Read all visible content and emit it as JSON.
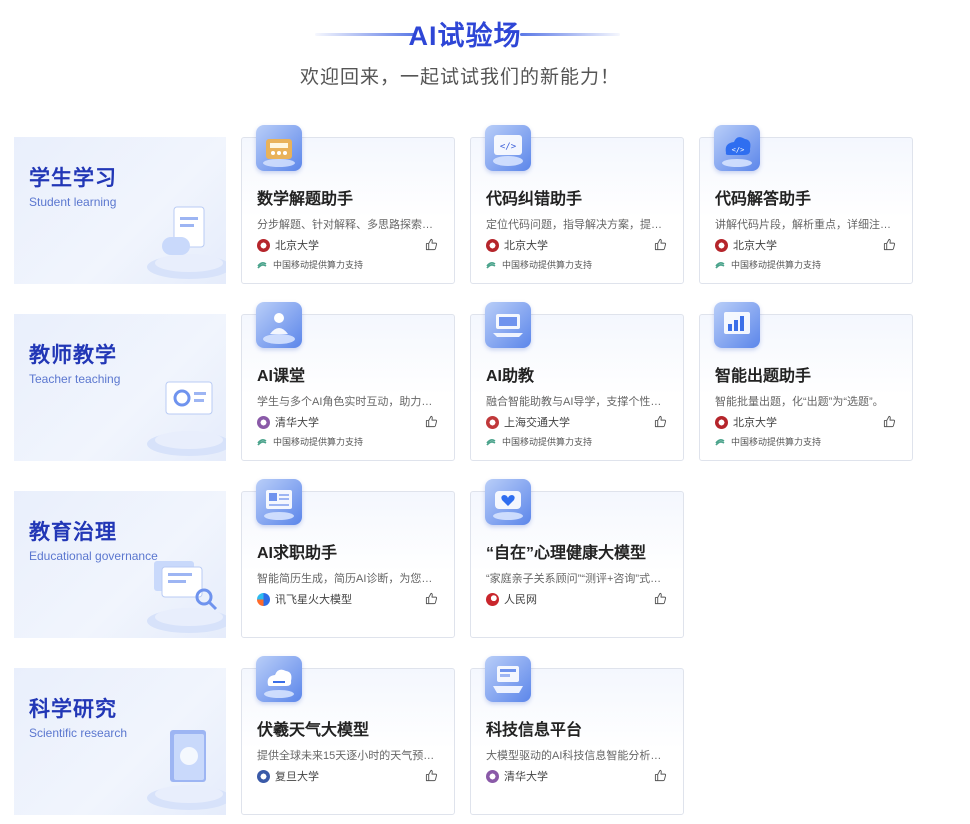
{
  "header": {
    "title": "AI试验场",
    "subtitle": "欢迎回来，一起试试我们的新能力！"
  },
  "power_text": "中国移动提供算力支持",
  "colors": {
    "accent": "#2e46d6",
    "category_bg": "#e9effc",
    "pku_red": "#b5252b",
    "tsinghua_purple": "#8a5aa8",
    "sjtu_red": "#c0383a",
    "cmcc_green": "#4aa38b"
  },
  "categories": [
    {
      "title": "学生学习",
      "subtitle": "Student learning",
      "illustration": "books-stack-icon",
      "cards": [
        {
          "title": "数学解题助手",
          "desc": "分步解题、针对解释、多思路探索…",
          "org": "北京大学",
          "icon": "math-calculator-icon",
          "power": true
        },
        {
          "title": "代码纠错助手",
          "desc": "定位代码问题，指导解决方案，提…",
          "org": "北京大学",
          "icon": "code-window-icon",
          "power": true
        },
        {
          "title": "代码解答助手",
          "desc": "讲解代码片段，解析重点，详细注…",
          "org": "北京大学",
          "icon": "cloud-code-icon",
          "power": true
        }
      ]
    },
    {
      "title": "教师教学",
      "subtitle": "Teacher teaching",
      "illustration": "teaching-screen-icon",
      "cards": [
        {
          "title": "AI课堂",
          "desc": "学生与多个AI角色实时互动，助力…",
          "org": "清华大学",
          "icon": "classroom-person-icon",
          "power": true
        },
        {
          "title": "AI助教",
          "desc": "融合智能助教与AI导学，支撑个性…",
          "org": "上海交通大学",
          "icon": "laptop-assistant-icon",
          "power": true
        },
        {
          "title": "智能出题助手",
          "desc": "智能批量出题，化“出题”为“选题”。",
          "org": "北京大学",
          "icon": "chart-board-icon",
          "power": true
        }
      ]
    },
    {
      "title": "教育治理",
      "subtitle": "Educational governance",
      "illustration": "documents-magnifier-icon",
      "cards": [
        {
          "title": "AI求职助手",
          "desc": "智能简历生成，简历AI诊断，为您…",
          "org": "讯飞星火大模型",
          "icon": "resume-screen-icon",
          "power": false
        },
        {
          "title": "“自在”心理健康大模型",
          "desc": "“家庭亲子关系顾问”“测评+咨询”式…",
          "org": "人民网",
          "icon": "heart-chat-icon",
          "power": false
        }
      ]
    },
    {
      "title": "科学研究",
      "subtitle": "Scientific research",
      "illustration": "research-book-icon",
      "cards": [
        {
          "title": "伏羲天气大模型",
          "desc": "提供全球未来15天逐小时的天气预…",
          "org": "复旦大学",
          "icon": "weather-cloud-icon",
          "power": false
        },
        {
          "title": "科技信息平台",
          "desc": "大模型驱动的AI科技信息智能分析…",
          "org": "清华大学",
          "icon": "tech-platform-icon",
          "power": false
        }
      ]
    }
  ]
}
